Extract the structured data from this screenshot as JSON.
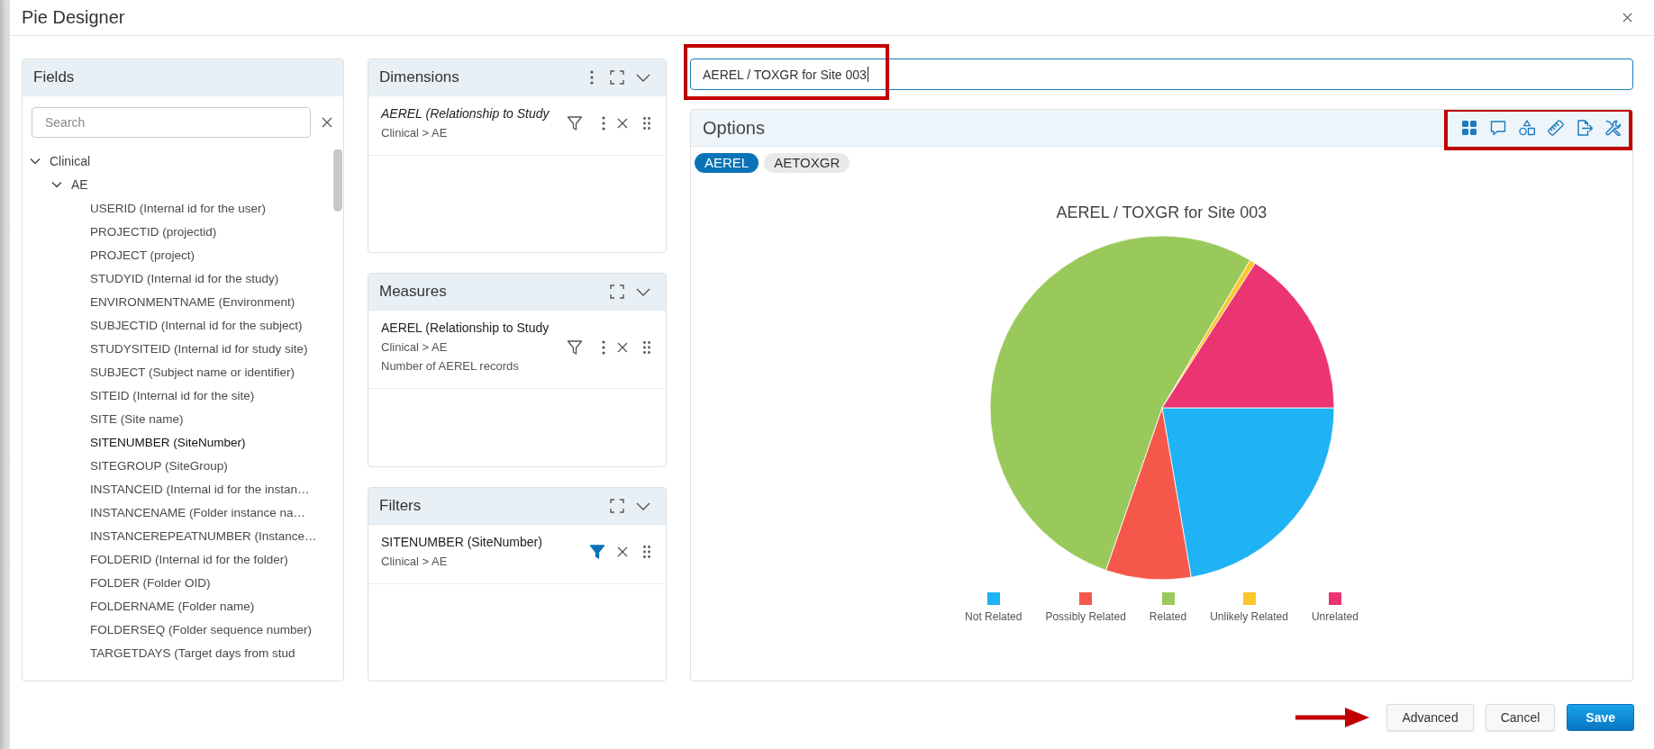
{
  "dialog": {
    "title": "Pie Designer"
  },
  "fields": {
    "title": "Fields",
    "search": {
      "placeholder": "Search"
    },
    "tree": [
      {
        "label": "Clinical",
        "expanded": true,
        "children": [
          {
            "label": "AE",
            "expanded": true,
            "children": [
              {
                "label": "USERID (Internal id for the user)",
                "highlighted": false
              },
              {
                "label": "PROJECTID (projectid)",
                "highlighted": false
              },
              {
                "label": "PROJECT (project)",
                "highlighted": false
              },
              {
                "label": "STUDYID (Internal id for the study)",
                "highlighted": false
              },
              {
                "label": "ENVIRONMENTNAME (Environment)",
                "highlighted": false
              },
              {
                "label": "SUBJECTID (Internal id for the subject)",
                "highlighted": false
              },
              {
                "label": "STUDYSITEID (Internal id for study site)",
                "highlighted": false
              },
              {
                "label": "SUBJECT (Subject name or identifier)",
                "highlighted": false
              },
              {
                "label": "SITEID (Internal id for the site)",
                "highlighted": false
              },
              {
                "label": "SITE (Site name)",
                "highlighted": false
              },
              {
                "label": "SITENUMBER (SiteNumber)",
                "highlighted": true
              },
              {
                "label": "SITEGROUP (SiteGroup)",
                "highlighted": false
              },
              {
                "label": "INSTANCEID (Internal id for the instan…",
                "highlighted": false
              },
              {
                "label": "INSTANCENAME (Folder instance na…",
                "highlighted": false
              },
              {
                "label": "INSTANCEREPEATNUMBER (Instance…",
                "highlighted": false
              },
              {
                "label": "FOLDERID (Internal id for the folder)",
                "highlighted": false
              },
              {
                "label": "FOLDER (Folder OID)",
                "highlighted": false
              },
              {
                "label": "FOLDERNAME (Folder name)",
                "highlighted": false
              },
              {
                "label": "FOLDERSEQ (Folder sequence number)",
                "highlighted": false
              },
              {
                "label": "TARGETDAYS (Target days from stud",
                "highlighted": false
              }
            ]
          }
        ]
      }
    ]
  },
  "panels": [
    {
      "title": "Dimensions",
      "menu": true,
      "items": [
        {
          "name": "AEREL (Relationship to Study",
          "italic": true,
          "path": "Clinical > AE",
          "filter_active": false,
          "menu": true
        }
      ]
    },
    {
      "title": "Measures",
      "menu": false,
      "items": [
        {
          "name": "AEREL (Relationship to Study",
          "italic": false,
          "path": "Clinical > AE",
          "detail": "Number of AEREL records",
          "filter_active": false,
          "menu": true
        }
      ]
    },
    {
      "title": "Filters",
      "menu": false,
      "items": [
        {
          "name": "SITENUMBER (SiteNumber)",
          "italic": false,
          "path": "Clinical > AE",
          "filter_active": true,
          "menu": false
        }
      ]
    }
  ],
  "chart_title": {
    "value": "AEREL / TOXGR for Site 003",
    "focused": true
  },
  "options": {
    "title": "Options",
    "series_tabs": [
      {
        "label": "AEREL",
        "selected": true
      },
      {
        "label": "AETOXGR",
        "selected": false
      }
    ]
  },
  "chart": {
    "title": "AEREL / TOXGR for Site 003",
    "legend": [
      {
        "label": "Not Related",
        "color": "#1fb2f4"
      },
      {
        "label": "Possibly Related",
        "color": "#f5584b"
      },
      {
        "label": "Related",
        "color": "#9ac95b"
      },
      {
        "label": "Unlikely Related",
        "color": "#fdc62b"
      },
      {
        "label": "Unrelated",
        "color": "#eb3472"
      }
    ]
  },
  "buttons": [
    {
      "label": "Advanced",
      "kind": "secondary"
    },
    {
      "label": "Cancel",
      "kind": "secondary"
    },
    {
      "label": "Save",
      "kind": "primary"
    }
  ]
}
